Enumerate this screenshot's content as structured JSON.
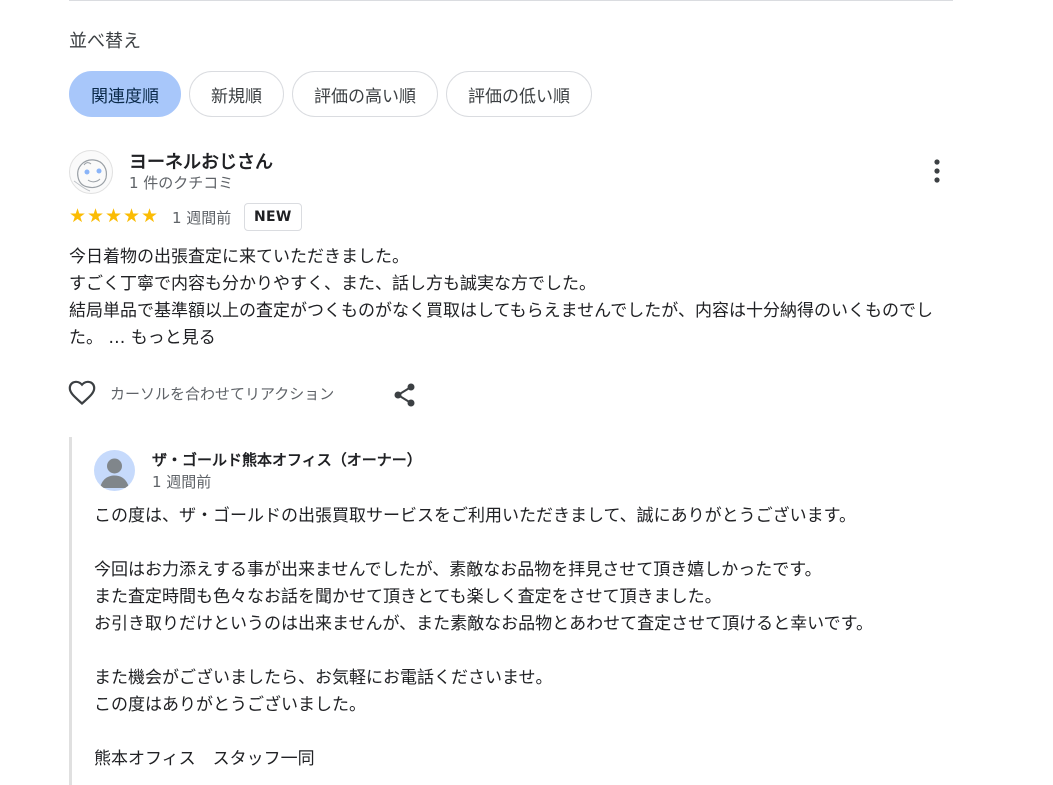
{
  "sort": {
    "label": "並べ替え",
    "chips": [
      "関連度順",
      "新規順",
      "評価の高い順",
      "評価の低い順"
    ],
    "active_index": 0
  },
  "review": {
    "name": "ヨーネルおじさん",
    "review_count": "1 件のクチコミ",
    "rating": 5,
    "stars": [
      "★",
      "★",
      "★",
      "★",
      "★"
    ],
    "time": "1 週間前",
    "badge": "NEW",
    "lines": [
      "今日着物の出張査定に来ていただきました。",
      "すごく丁寧で内容も分かりやすく、また、話し方も誠実な方でした。",
      "結局単品で基準額以上の査定がつくものがなく買取はしてもらえませんでしたが、内容は十分納得のいくものでした。"
    ],
    "more_label": "… もっと見る",
    "reaction_label": "カーソルを合わせてリアクション"
  },
  "reply": {
    "owner_name": "ザ・ゴールド熊本オフィス（オーナー）",
    "time": "1 週間前",
    "lines": [
      "この度は、ザ・ゴールドの出張買取サービスをご利用いただきまして、誠にありがとうございます。",
      "",
      "今回はお力添えする事が出来ませんでしたが、素敵なお品物を拝見させて頂き嬉しかったです。",
      "また査定時間も色々なお話を聞かせて頂きとても楽しく査定をさせて頂きました。",
      "お引き取りだけというのは出来ませんが、また素敵なお品物とあわせて査定させて頂けると幸いです。",
      "",
      "また機会がございましたら、お気軽にお電話くださいませ。",
      "この度はありがとうございました。",
      "",
      "熊本オフィス　スタッフ一同"
    ]
  },
  "colors": {
    "active_chip": "#a8c7fa",
    "star": "#fbbc04",
    "secondary_text": "#5f6368"
  }
}
